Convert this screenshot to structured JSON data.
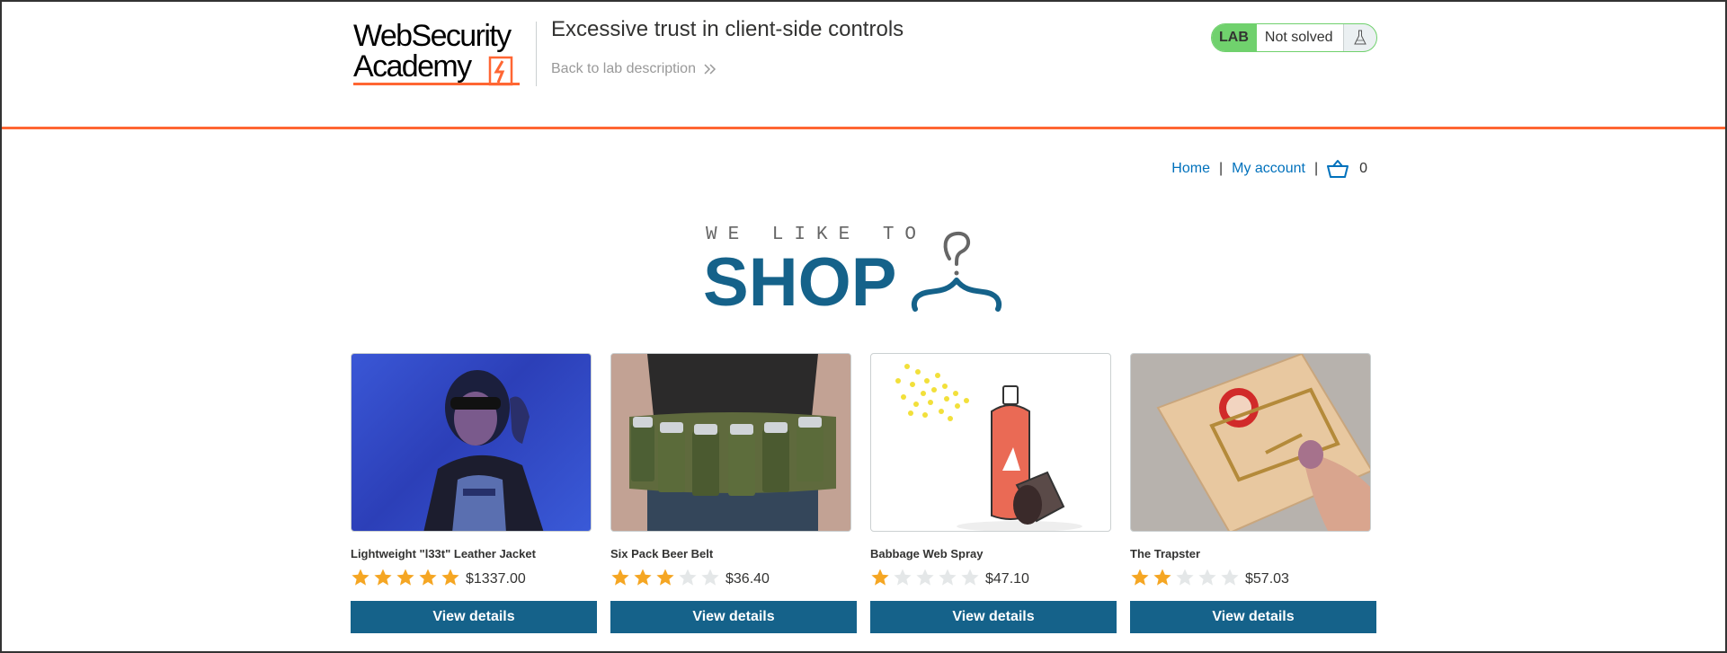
{
  "header": {
    "logo_line1": "WebSecurity",
    "logo_line2": "Academy",
    "lab_title": "Excessive trust in client-side controls",
    "back_link": "Back to lab description",
    "lab_badge": "LAB",
    "lab_status": "Not solved",
    "icons": {
      "flask": "flask-icon",
      "chevrons": "double-chevron-right-icon"
    }
  },
  "nav": {
    "home": "Home",
    "separator": "|",
    "my_account": "My account",
    "cart_count": "0",
    "icons": {
      "cart": "cart-icon"
    }
  },
  "hero": {
    "small": "WE LIKE TO",
    "big": "SHOP",
    "icons": {
      "hanger": "hanger-icon"
    }
  },
  "colors": {
    "accent": "#ff6633",
    "brand_blue": "#15628a",
    "link_blue": "#0071bc",
    "star_gold": "#f5a623",
    "star_empty": "#e4e7e8",
    "lab_green": "#70d16d"
  },
  "products": [
    {
      "name": "Lightweight \"l33t\" Leather Jacket",
      "rating": 5,
      "price": "$1337.00",
      "button": "View details"
    },
    {
      "name": "Six Pack Beer Belt",
      "rating": 3,
      "price": "$36.40",
      "button": "View details"
    },
    {
      "name": "Babbage Web Spray",
      "rating": 1,
      "price": "$47.10",
      "button": "View details"
    },
    {
      "name": "The Trapster",
      "rating": 2,
      "price": "$57.03",
      "button": "View details"
    }
  ]
}
